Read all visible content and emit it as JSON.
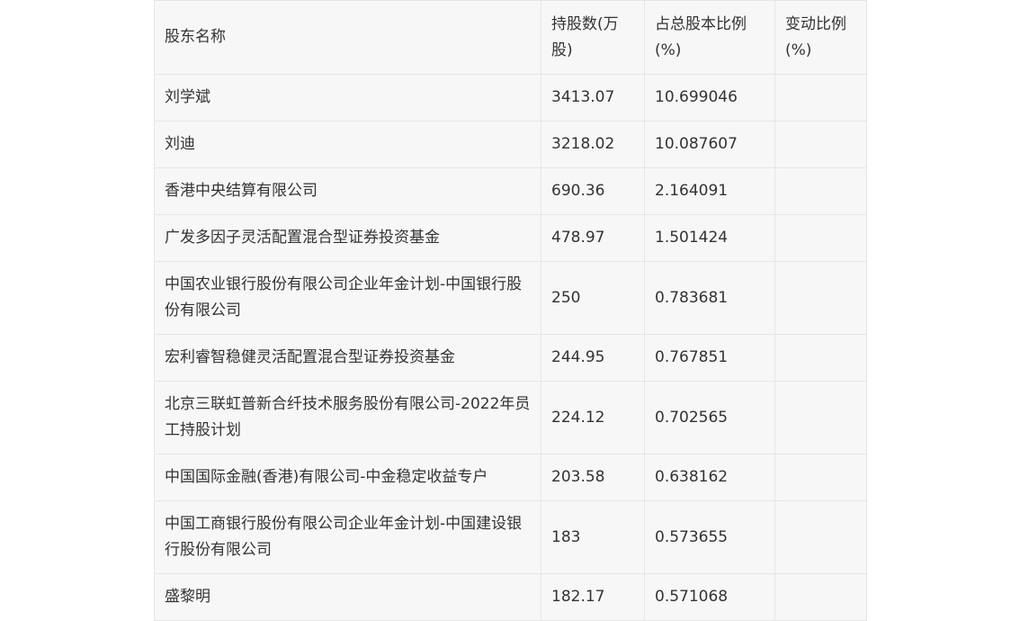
{
  "table": {
    "headers": {
      "name": "股东名称",
      "shares": "持股数(万股)",
      "pct": "占总股本比例(%)",
      "change": "变动比例(%)"
    },
    "rows": [
      {
        "name": "刘学斌",
        "shares": "3413.07",
        "pct": "10.699046",
        "change": ""
      },
      {
        "name": "刘迪",
        "shares": "3218.02",
        "pct": "10.087607",
        "change": ""
      },
      {
        "name": "香港中央结算有限公司",
        "shares": "690.36",
        "pct": "2.164091",
        "change": ""
      },
      {
        "name": "广发多因子灵活配置混合型证券投资基金",
        "shares": "478.97",
        "pct": "1.501424",
        "change": ""
      },
      {
        "name": "中国农业银行股份有限公司企业年金计划-中国银行股份有限公司",
        "shares": "250",
        "pct": "0.783681",
        "change": ""
      },
      {
        "name": "宏利睿智稳健灵活配置混合型证券投资基金",
        "shares": "244.95",
        "pct": "0.767851",
        "change": ""
      },
      {
        "name": "北京三联虹普新合纤技术服务股份有限公司-2022年员工持股计划",
        "shares": "224.12",
        "pct": "0.702565",
        "change": ""
      },
      {
        "name": "中国国际金融(香港)有限公司-中金稳定收益专户",
        "shares": "203.58",
        "pct": "0.638162",
        "change": ""
      },
      {
        "name": "中国工商银行股份有限公司企业年金计划-中国建设银行股份有限公司",
        "shares": "183",
        "pct": "0.573655",
        "change": ""
      },
      {
        "name": "盛黎明",
        "shares": "182.17",
        "pct": "0.571068",
        "change": ""
      }
    ]
  }
}
